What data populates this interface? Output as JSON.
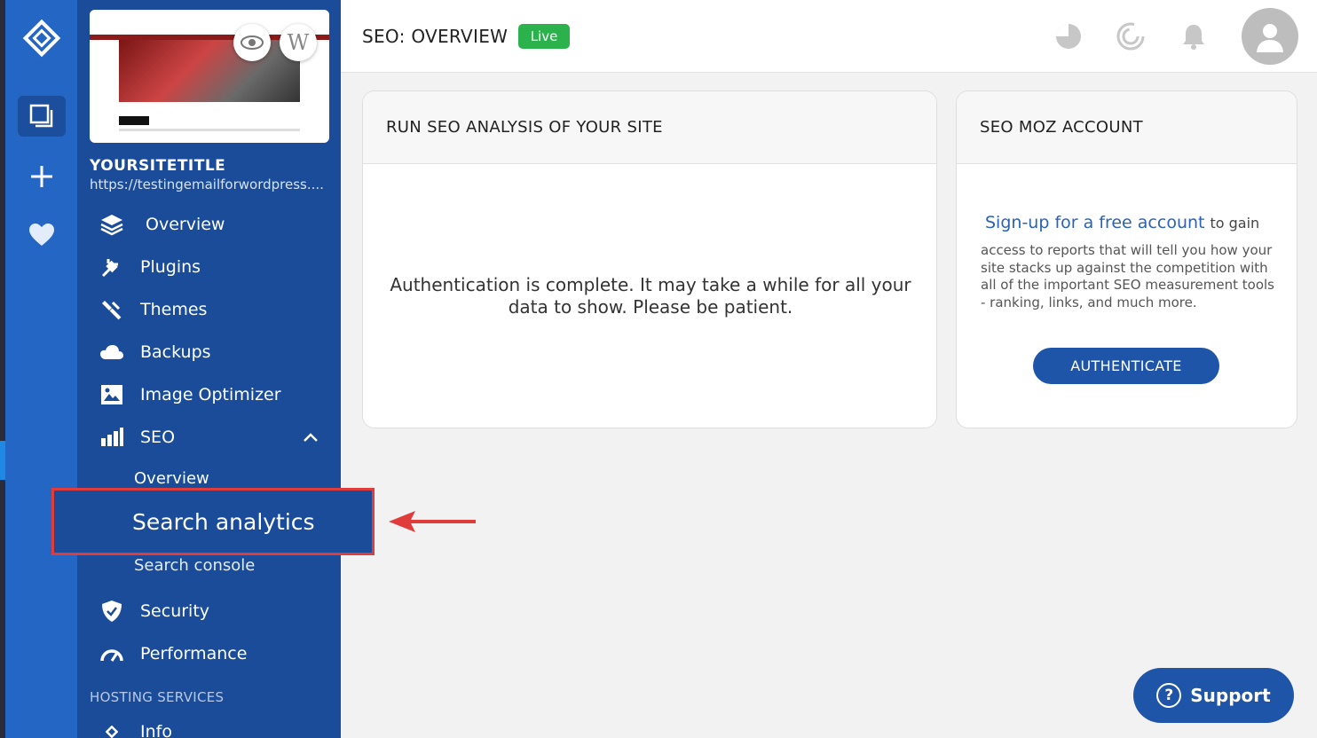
{
  "site": {
    "title": "YOURSITETITLE",
    "url": "https://testingemailforwordpress...."
  },
  "nav": {
    "items": [
      {
        "label": "Overview",
        "icon": "layers-icon"
      },
      {
        "label": "Plugins",
        "icon": "plug-icon"
      },
      {
        "label": "Themes",
        "icon": "paintbrush-icon"
      },
      {
        "label": "Backups",
        "icon": "cloud-icon"
      },
      {
        "label": "Image Optimizer",
        "icon": "image-icon"
      },
      {
        "label": "SEO",
        "icon": "bar-chart-icon"
      },
      {
        "label": "Security",
        "icon": "shield-icon"
      },
      {
        "label": "Performance",
        "icon": "gauge-icon"
      }
    ],
    "seo_sub": [
      "Overview",
      "Search analytics",
      "Search console"
    ],
    "hosting_header": "HOSTING SERVICES",
    "info_label": "Info"
  },
  "header": {
    "title": "SEO: OVERVIEW",
    "badge": "Live"
  },
  "cards": {
    "analysis": {
      "title": "RUN SEO ANALYSIS OF YOUR SITE",
      "message": "Authentication is complete. It may take a while for all your data to show. Please be patient."
    },
    "moz": {
      "title": "SEO MOZ ACCOUNT",
      "signup_link": "Sign-up for a free account",
      "signup_suffix": "to gain",
      "description": "access to reports that will tell you how your site stacks up against the competition with all of the important SEO measurement tools - ranking, links, and much more.",
      "button": "AUTHENTICATE"
    }
  },
  "support_label": "Support",
  "colors": {
    "rail": "#2366c4",
    "nav": "#1a4c9a",
    "live": "#2bb24c",
    "button": "#1e55a8",
    "highlight_border": "#e03c3c"
  }
}
